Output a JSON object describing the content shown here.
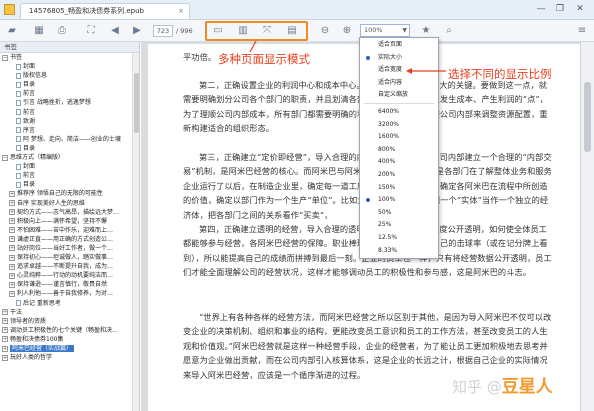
{
  "window": {
    "tab_title": "14576805_畅盈和决债券系列.epub",
    "close_tab": "×",
    "minimize": "—",
    "restore": "❐",
    "close": "✕"
  },
  "toolbar": {
    "current_page": "723",
    "total_pages": "/ 996",
    "zoom_value": "100%"
  },
  "sidebar": {
    "header": "书签",
    "items": [
      {
        "label": "书签",
        "exp": "−",
        "level": 0
      },
      {
        "label": "封面",
        "level": 2
      },
      {
        "label": "版权信息",
        "level": 2
      },
      {
        "label": "目录",
        "level": 2
      },
      {
        "label": "前言",
        "level": 2
      },
      {
        "label": "引言 战略挫折，逃逸梦想",
        "level": 2
      },
      {
        "label": "前言",
        "level": 2
      },
      {
        "label": "致谢",
        "level": 2
      },
      {
        "label": "序言",
        "level": 2
      },
      {
        "label": "阿 梦想、走向、简洁——创业的士壤",
        "level": 2
      },
      {
        "label": "目录",
        "level": 2
      },
      {
        "label": "思维方式（精编版）",
        "exp": "−",
        "level": 0
      },
      {
        "label": "封面",
        "level": 2
      },
      {
        "label": "前言",
        "level": 2
      },
      {
        "label": "目录",
        "level": 2
      },
      {
        "label": "推荐序 领悟自己的无限的可能性",
        "exp": "+",
        "level": 1
      },
      {
        "label": "自序 实现美好人生的思维",
        "exp": "+",
        "level": 1
      },
      {
        "label": "契约方式——志气高昂，描绘远大梦…",
        "exp": "+",
        "level": 1
      },
      {
        "label": "积极向上——满怀希望，坚持不懈",
        "exp": "+",
        "level": 1
      },
      {
        "label": "不怕困难——苦中作乐，迎难而上…",
        "exp": "+",
        "level": 1
      },
      {
        "label": "谦虚正直——用正确的方式创造公…",
        "exp": "+",
        "level": 1
      },
      {
        "label": "站好岗位——当好工作者，做一个…",
        "exp": "+",
        "level": 1
      },
      {
        "label": "保持初心——坦诚做人，踏实做事…",
        "exp": "+",
        "level": 1
      },
      {
        "label": "追求卓越——不断提升自我，成为…",
        "exp": "+",
        "level": 1
      },
      {
        "label": "心灵纯粹——行动的动机要纯洁而…",
        "exp": "+",
        "level": 1
      },
      {
        "label": "保持谦逊——谨言慎行，敬畏自然",
        "exp": "+",
        "level": 1
      },
      {
        "label": "利人利他——善于自我修养，为对…",
        "exp": "+",
        "level": 1
      },
      {
        "label": "后记 重新思考",
        "level": 2
      },
      {
        "label": "干法",
        "exp": "+",
        "level": 0
      },
      {
        "label": "领导者的资质",
        "exp": "+",
        "level": 0
      },
      {
        "label": "调动员工积极性的七个关键（畅盈和决…",
        "exp": "+",
        "level": 0
      },
      {
        "label": "畅盈和决债券100集",
        "exp": "+",
        "level": 0
      },
      {
        "label": "阿米巴经营（实战篇）",
        "exp": "+",
        "level": 0,
        "selected": true
      },
      {
        "label": "玩好人类的哲学",
        "exp": "+",
        "level": 0
      }
    ]
  },
  "document": {
    "paragraphs": [
      "平功倍。",
      "第二，正确设置企业的利润中心和成本中心。这是一个企业能否做大的关键。要做到这一点，就需要明确划分公司各个部门的职责，并且划清各部门之间的边界，以及发生成本、产生利润的“点”，为了理顺公司内部成本，所有部门都需要明确的利润责任。这样可以使公司内部来调整资源配置，重新构建适合的组织形态。",
      "第三，正确建立“定价即经营”，导入合理的内部交易价格。要在公司内部建立一个合理的“内部交易”机制，是阿米巴经营的核心。而阿米巴与阿米巴之间的交易价格，是各部门在了解整体业务和服务企业运行了以后，在制造企业里，确定每一道工序的附加值，就是需要确定各阿米巴在流程中所创造的价值，确定以部门作为一个生产“单位”。比如大部分情况下，可以把一个“实体”当作一个独立的经济体，把各部门之间的关系看作“买卖”，",
      "第四，正确建立透明的经营，导入合理的透明机制。第四就是透明度公开透明，如何使全体员工都能够参与经营，各阿米巴经营的保障。职业棒球选手因为能够看到自己的击球率（或在记分牌上看到），所以能提高自己的成绩而拼搏到最后一刻。企业的员工也一样，只有将经营数据公开透明，员工们才能全面理解公司的经营状况，这样才能够调动员工的积极性和参与感，这是阿米巴的斗志。",
      "“世界上有各种各样的经营方法，而阿米巴经营之所以区别于其他，是因为导入阿米巴不仅可以改变企业的决策机制、组织和事业的结构，更能改变员工意识和员工的工作方法，甚至改变员工的人生观和价值观。”阿米巴经营就是这样一种经营手段，企业的经营者，为了能让员工更加积极地去思考并愿意为企业做出贡献，而在公司内部引入核算体系，这是企业的长远之计，根据自己企业的实际情况来导入阿米巴经营，应该是一个循序渐进的过程。"
    ]
  },
  "zoom_menu": {
    "items": [
      {
        "label": "适合页面",
        "checked": false
      },
      {
        "label": "实际大小",
        "checked": true
      },
      {
        "label": "适合宽度",
        "checked": false
      },
      {
        "label": "适合内容",
        "checked": false
      },
      {
        "label": "自定义缩放",
        "checked": false
      },
      {
        "label": "6400%",
        "checked": false
      },
      {
        "label": "3200%",
        "checked": false
      },
      {
        "label": "1600%",
        "checked": false
      },
      {
        "label": "800%",
        "checked": false
      },
      {
        "label": "400%",
        "checked": false
      },
      {
        "label": "200%",
        "checked": false
      },
      {
        "label": "150%",
        "checked": false
      },
      {
        "label": "100%",
        "checked": true
      },
      {
        "label": "50%",
        "checked": false
      },
      {
        "label": "25%",
        "checked": false
      },
      {
        "label": "12.5%",
        "checked": false
      },
      {
        "label": "8.33%",
        "checked": false
      }
    ]
  },
  "annotations": {
    "page_modes": "多种页面显示模式",
    "zoom_ratios": "选择不同的显示比例"
  },
  "watermark": {
    "text": "知乎 @",
    "brand": "豆星人"
  },
  "colors": {
    "annotation": "#e8401e",
    "highlight_box": "#f08a24",
    "selection": "#3a78c9"
  }
}
